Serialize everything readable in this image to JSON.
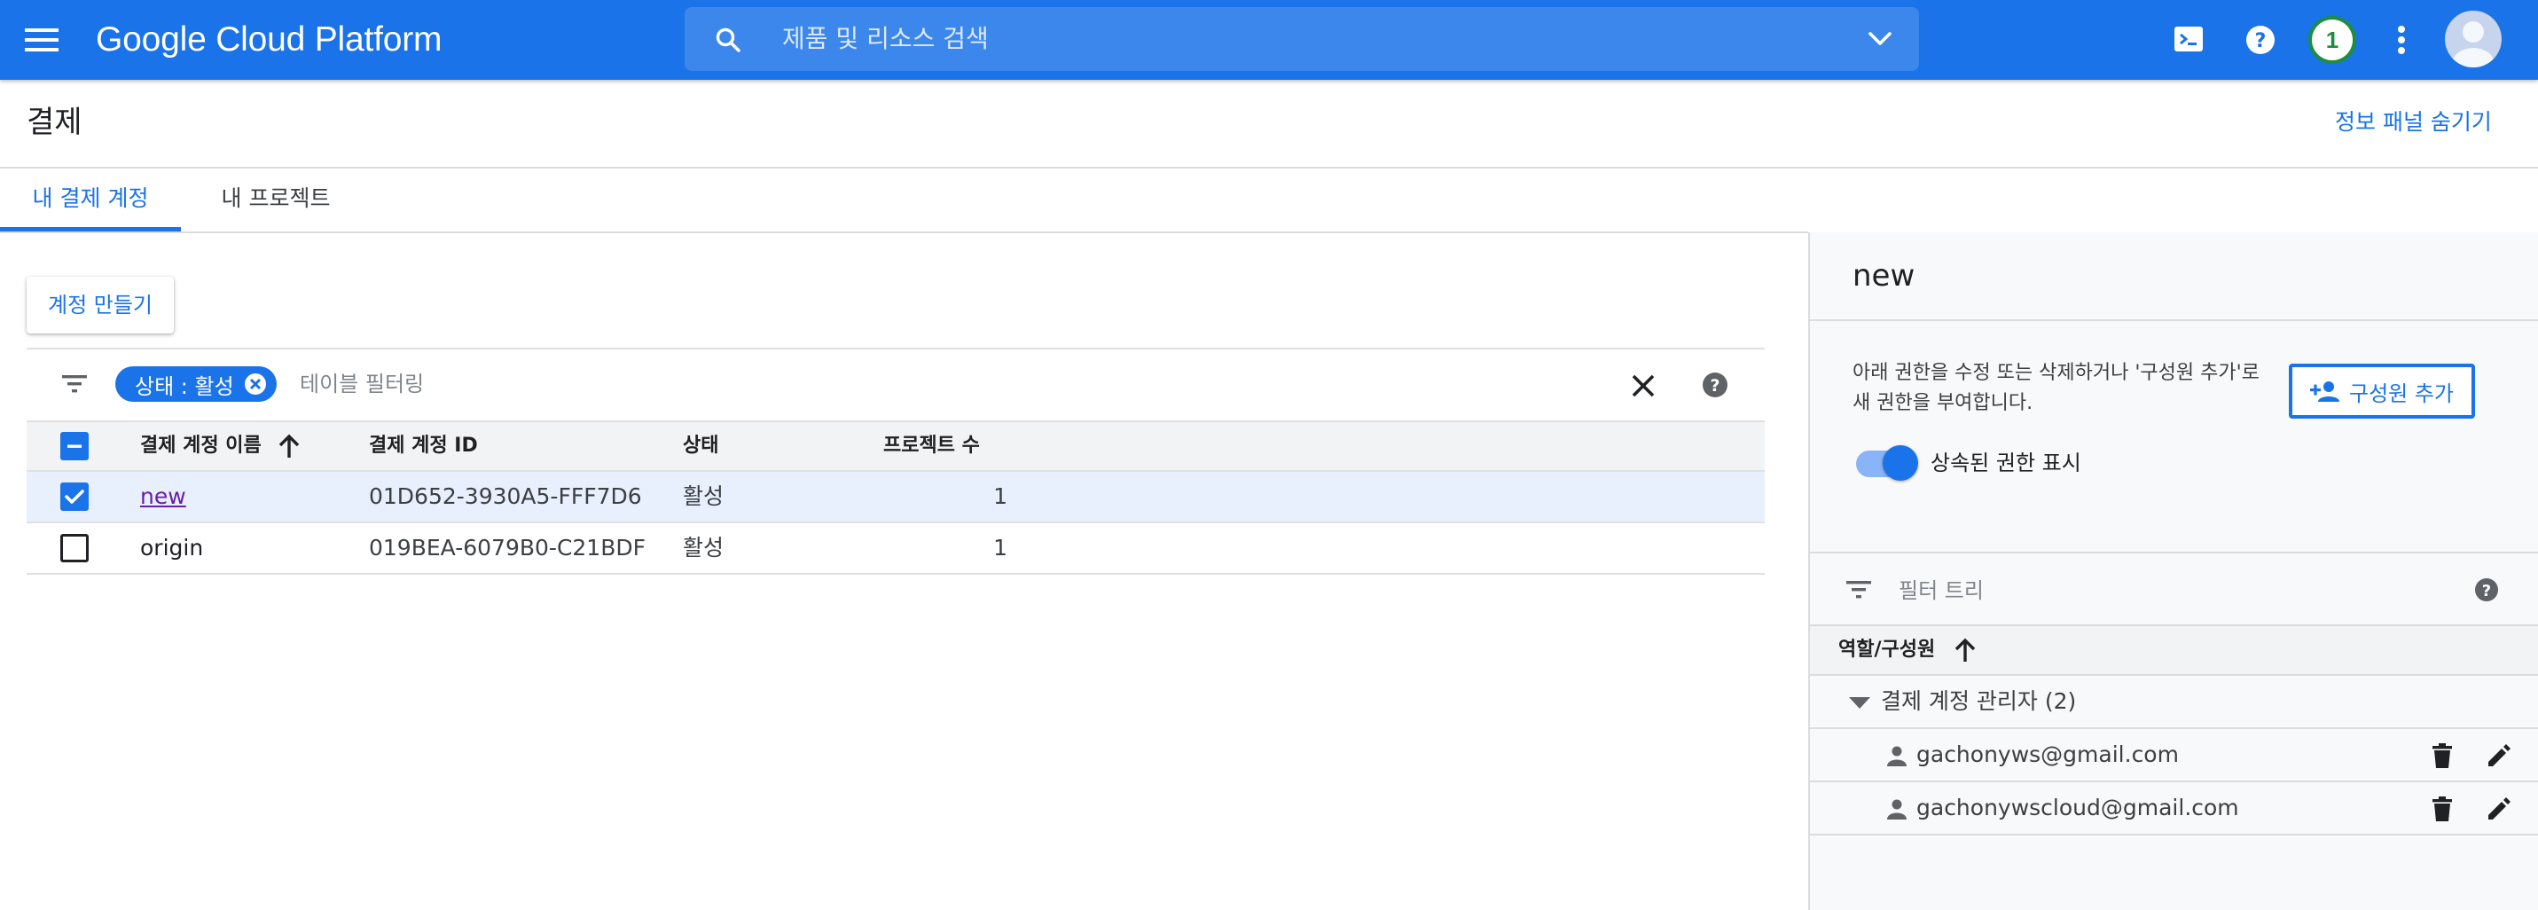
{
  "topbar": {
    "app_title": "Google Cloud Platform",
    "search_placeholder": "제품 및 리소스 검색",
    "notification_count": "1",
    "icons": [
      "menu-icon",
      "search-icon",
      "chevron-down-icon",
      "cloud-shell-icon",
      "help-icon",
      "more-vert-icon",
      "avatar"
    ]
  },
  "header": {
    "title": "결제",
    "toggle_info_panel": "정보 패널 숨기기"
  },
  "tabs": [
    {
      "label": "내 결제 계정",
      "active": true
    },
    {
      "label": "내 프로젝트",
      "active": false
    }
  ],
  "actions": {
    "create_account": "계정 만들기"
  },
  "filter": {
    "chip_label": "상태 : 활성",
    "placeholder": "테이블 필터링"
  },
  "table": {
    "columns": [
      "결제 계정 이름",
      "결제 계정 ID",
      "상태",
      "프로젝트 수"
    ],
    "sort_column": "결제 계정 이름",
    "sort_direction": "ascending",
    "rows": [
      {
        "name": "new",
        "id": "01D652-3930A5-FFF7D6",
        "status": "활성",
        "projects": "1",
        "selected": true
      },
      {
        "name": "origin",
        "id": "019BEA-6079B0-C21BDF",
        "status": "활성",
        "projects": "1",
        "selected": false
      }
    ]
  },
  "info_panel": {
    "title": "new",
    "description": "아래 권한을 수정 또는 삭제하거나 '구성원 추가'로 새 권한을 부여합니다.",
    "add_member": "구성원 추가",
    "inherited_label": "상속된 권한 표시",
    "inherited_on": true,
    "filter_placeholder": "필터 트리",
    "column_header": "역할/구성원",
    "role": {
      "label": "결제 계정 관리자 (2)",
      "expanded": true,
      "members": [
        "gachonyws@gmail.com",
        "gachonywscloud@gmail.com"
      ]
    }
  },
  "colors": {
    "brand_blue": "#1a73e8",
    "chip_blue": "#1a73e8",
    "selected_row": "#e8f0fe",
    "panel_bg": "#f8f9fa",
    "notification_green": "#1e8e3e"
  }
}
